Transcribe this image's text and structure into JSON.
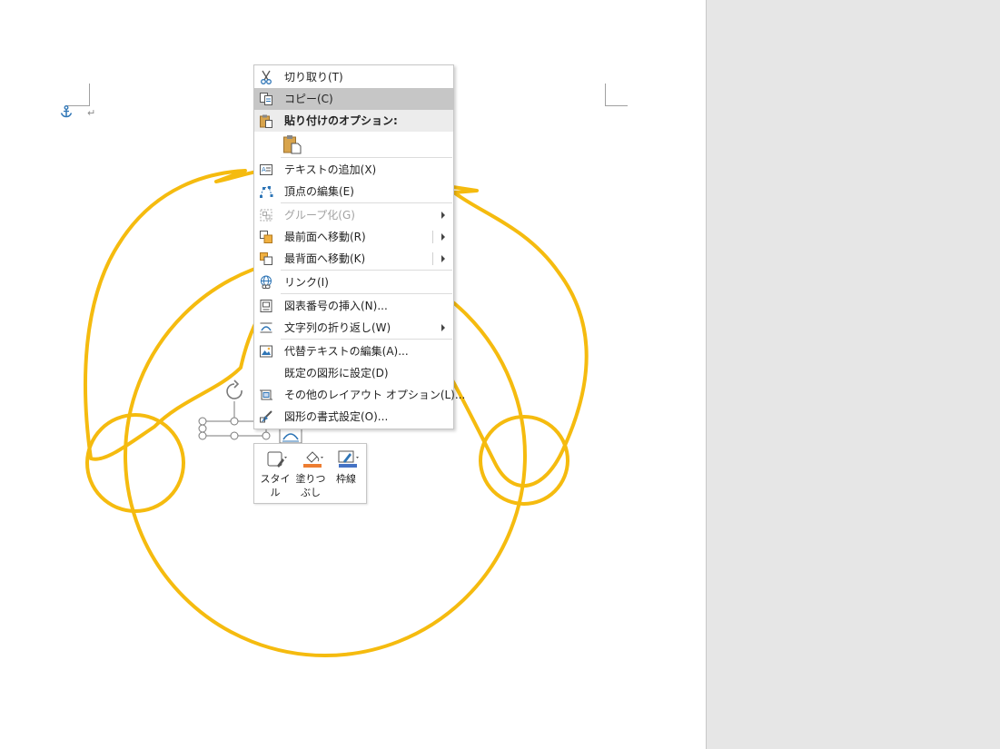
{
  "context_menu": {
    "items": [
      {
        "label": "切り取り(T)",
        "icon": "scissors-icon"
      },
      {
        "label": "コピー(C)",
        "icon": "copy-icon",
        "selected": true
      },
      {
        "label": "貼り付けのオプション:",
        "icon": "paste-icon",
        "header": true
      },
      {
        "label": "テキストの追加(X)",
        "icon": "add-text-icon"
      },
      {
        "label": "頂点の編集(E)",
        "icon": "edit-points-icon"
      },
      {
        "label": "グループ化(G)",
        "icon": "group-icon",
        "disabled": true
      },
      {
        "label": "最前面へ移動(R)",
        "icon": "bring-to-front-icon"
      },
      {
        "label": "最背面へ移動(K)",
        "icon": "send-to-back-icon"
      },
      {
        "label": "リンク(I)",
        "icon": "link-icon"
      },
      {
        "label": "図表番号の挿入(N)...",
        "icon": "insert-caption-icon"
      },
      {
        "label": "文字列の折り返し(W)",
        "icon": "wrap-text-icon"
      },
      {
        "label": "代替テキストの編集(A)...",
        "icon": "alt-text-icon"
      },
      {
        "label": "既定の図形に設定(D)",
        "icon": ""
      },
      {
        "label": "その他のレイアウト オプション(L)...",
        "icon": "layout-options-icon"
      },
      {
        "label": "図形の書式設定(O)...",
        "icon": "format-shape-icon"
      }
    ],
    "paste_option_icon": "paste-keep-source-icon"
  },
  "mini_toolbar": {
    "style_label": "スタイル",
    "fill_label": "塗りつぶし",
    "outline_label": "枠線",
    "fill_color": "#ed7d31",
    "outline_color": "#4472c4"
  },
  "colors": {
    "shape_stroke": "#f5bb0f",
    "icon_blue": "#2e75b6",
    "menu_selected": "#c6c6c6",
    "workspace": "#e6e6e6"
  },
  "document": {
    "paragraph_mark": "↵",
    "anchor_icon": "anchor-icon"
  }
}
